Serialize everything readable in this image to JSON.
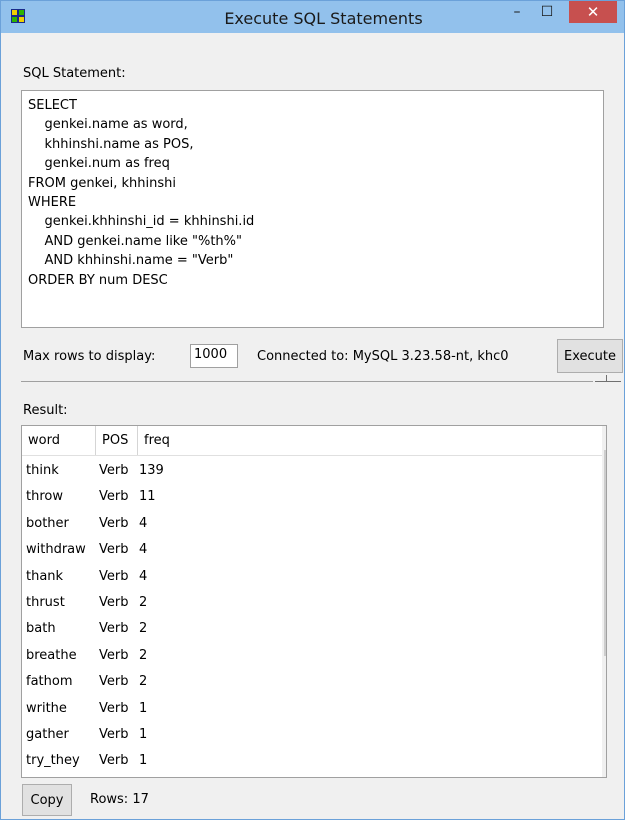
{
  "window": {
    "title": "Execute SQL Statements",
    "minimize_glyph": "–",
    "maximize_glyph": "☐",
    "close_glyph": "✕"
  },
  "sql": {
    "label": "SQL Statement:",
    "lines": [
      "SELECT",
      "    genkei.name as word,",
      "    khhinshi.name as POS,",
      "    genkei.num as freq",
      "FROM genkei, khhinshi",
      "WHERE",
      "    genkei.khhinshi_id = khhinshi.id",
      "    AND genkei.name like \"%th%\"",
      "    AND khhinshi.name = \"Verb\"",
      "ORDER BY num DESC"
    ]
  },
  "controls": {
    "max_rows_label": "Max rows to display:",
    "max_rows_value": "1000",
    "connection": "Connected to: MySQL 3.23.58-nt, khc0",
    "execute_label": "Execute"
  },
  "result": {
    "label": "Result:",
    "columns": [
      "word",
      "POS",
      "freq"
    ],
    "rows": [
      [
        "think",
        "Verb",
        "139"
      ],
      [
        "throw",
        "Verb",
        "11"
      ],
      [
        "bother",
        "Verb",
        "4"
      ],
      [
        "withdraw",
        "Verb",
        "4"
      ],
      [
        "thank",
        "Verb",
        "4"
      ],
      [
        "thrust",
        "Verb",
        "2"
      ],
      [
        "bath",
        "Verb",
        "2"
      ],
      [
        "breathe",
        "Verb",
        "2"
      ],
      [
        "fathom",
        "Verb",
        "2"
      ],
      [
        "writhe",
        "Verb",
        "1"
      ],
      [
        "gather",
        "Verb",
        "1"
      ],
      [
        "try_they",
        "Verb",
        "1"
      ]
    ],
    "scroll_up_glyph": "▲",
    "scroll_down_glyph": "▼"
  },
  "footer": {
    "copy_label": "Copy",
    "rows_text": "Rows: 17"
  },
  "colors": {
    "titlebar": "#92c1ec",
    "close_button": "#c7504f",
    "window_bg": "#f0f0f0"
  }
}
